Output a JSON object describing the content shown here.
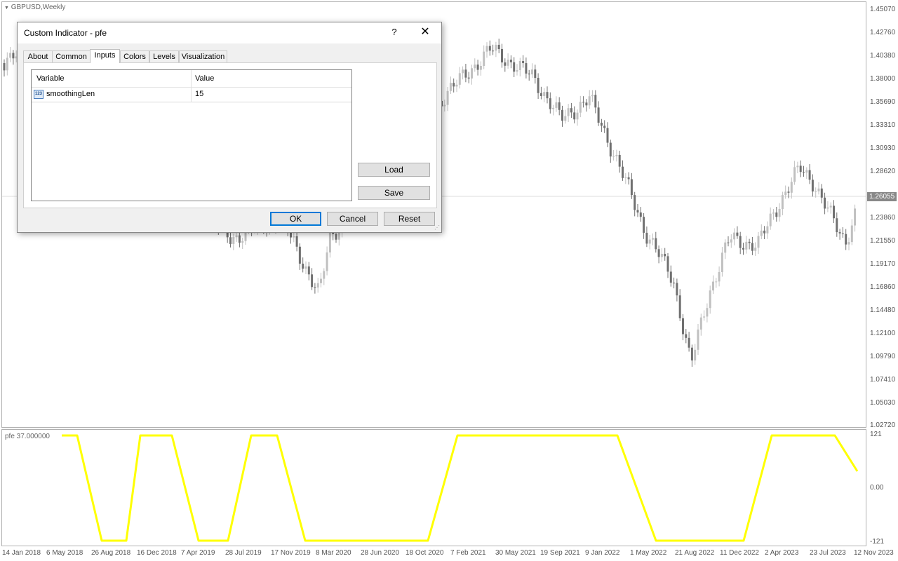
{
  "chart": {
    "symbol_label": "GBPUSD,Weekly",
    "price_ticks": [
      "1.45070",
      "1.42760",
      "1.40380",
      "1.38000",
      "1.35690",
      "1.33310",
      "1.30930",
      "1.28620",
      "1.23860",
      "1.21550",
      "1.19170",
      "1.16860",
      "1.14480",
      "1.12100",
      "1.09790",
      "1.07410",
      "1.05030",
      "1.02720"
    ],
    "current_price": "1.26055",
    "date_ticks": [
      "14 Jan 2018",
      "6 May 2018",
      "26 Aug 2018",
      "16 Dec 2018",
      "7 Apr 2019",
      "28 Jul 2019",
      "17 Nov 2019",
      "8 Mar 2020",
      "28 Jun 2020",
      "18 Oct 2020",
      "7 Feb 2021",
      "30 May 2021",
      "19 Sep 2021",
      "9 Jan 2022",
      "1 May 2022",
      "21 Aug 2022",
      "11 Dec 2022",
      "2 Apr 2023",
      "23 Jul 2023",
      "12 Nov 2023"
    ],
    "colors": {
      "bull": "#c0c0c0",
      "bear": "#707070",
      "indicator_line": "#ffff00"
    }
  },
  "indicator": {
    "label": "pfe 37.000000",
    "ticks": [
      "121",
      "0.00",
      "-121"
    ]
  },
  "dialog": {
    "title": "Custom Indicator - pfe",
    "help_glyph": "?",
    "close_glyph": "✕",
    "tabs": [
      {
        "label": "About"
      },
      {
        "label": "Common"
      },
      {
        "label": "Inputs"
      },
      {
        "label": "Colors"
      },
      {
        "label": "Levels"
      },
      {
        "label": "Visualization"
      }
    ],
    "active_tab": "Inputs",
    "grid": {
      "col_variable": "Variable",
      "col_value": "Value",
      "rows": [
        {
          "icon": "integer-type-icon",
          "icon_text": "123",
          "variable": "smoothingLen",
          "value": "15"
        }
      ]
    },
    "buttons": {
      "load": "Load",
      "save": "Save",
      "ok": "OK",
      "cancel": "Cancel",
      "reset": "Reset"
    }
  }
}
